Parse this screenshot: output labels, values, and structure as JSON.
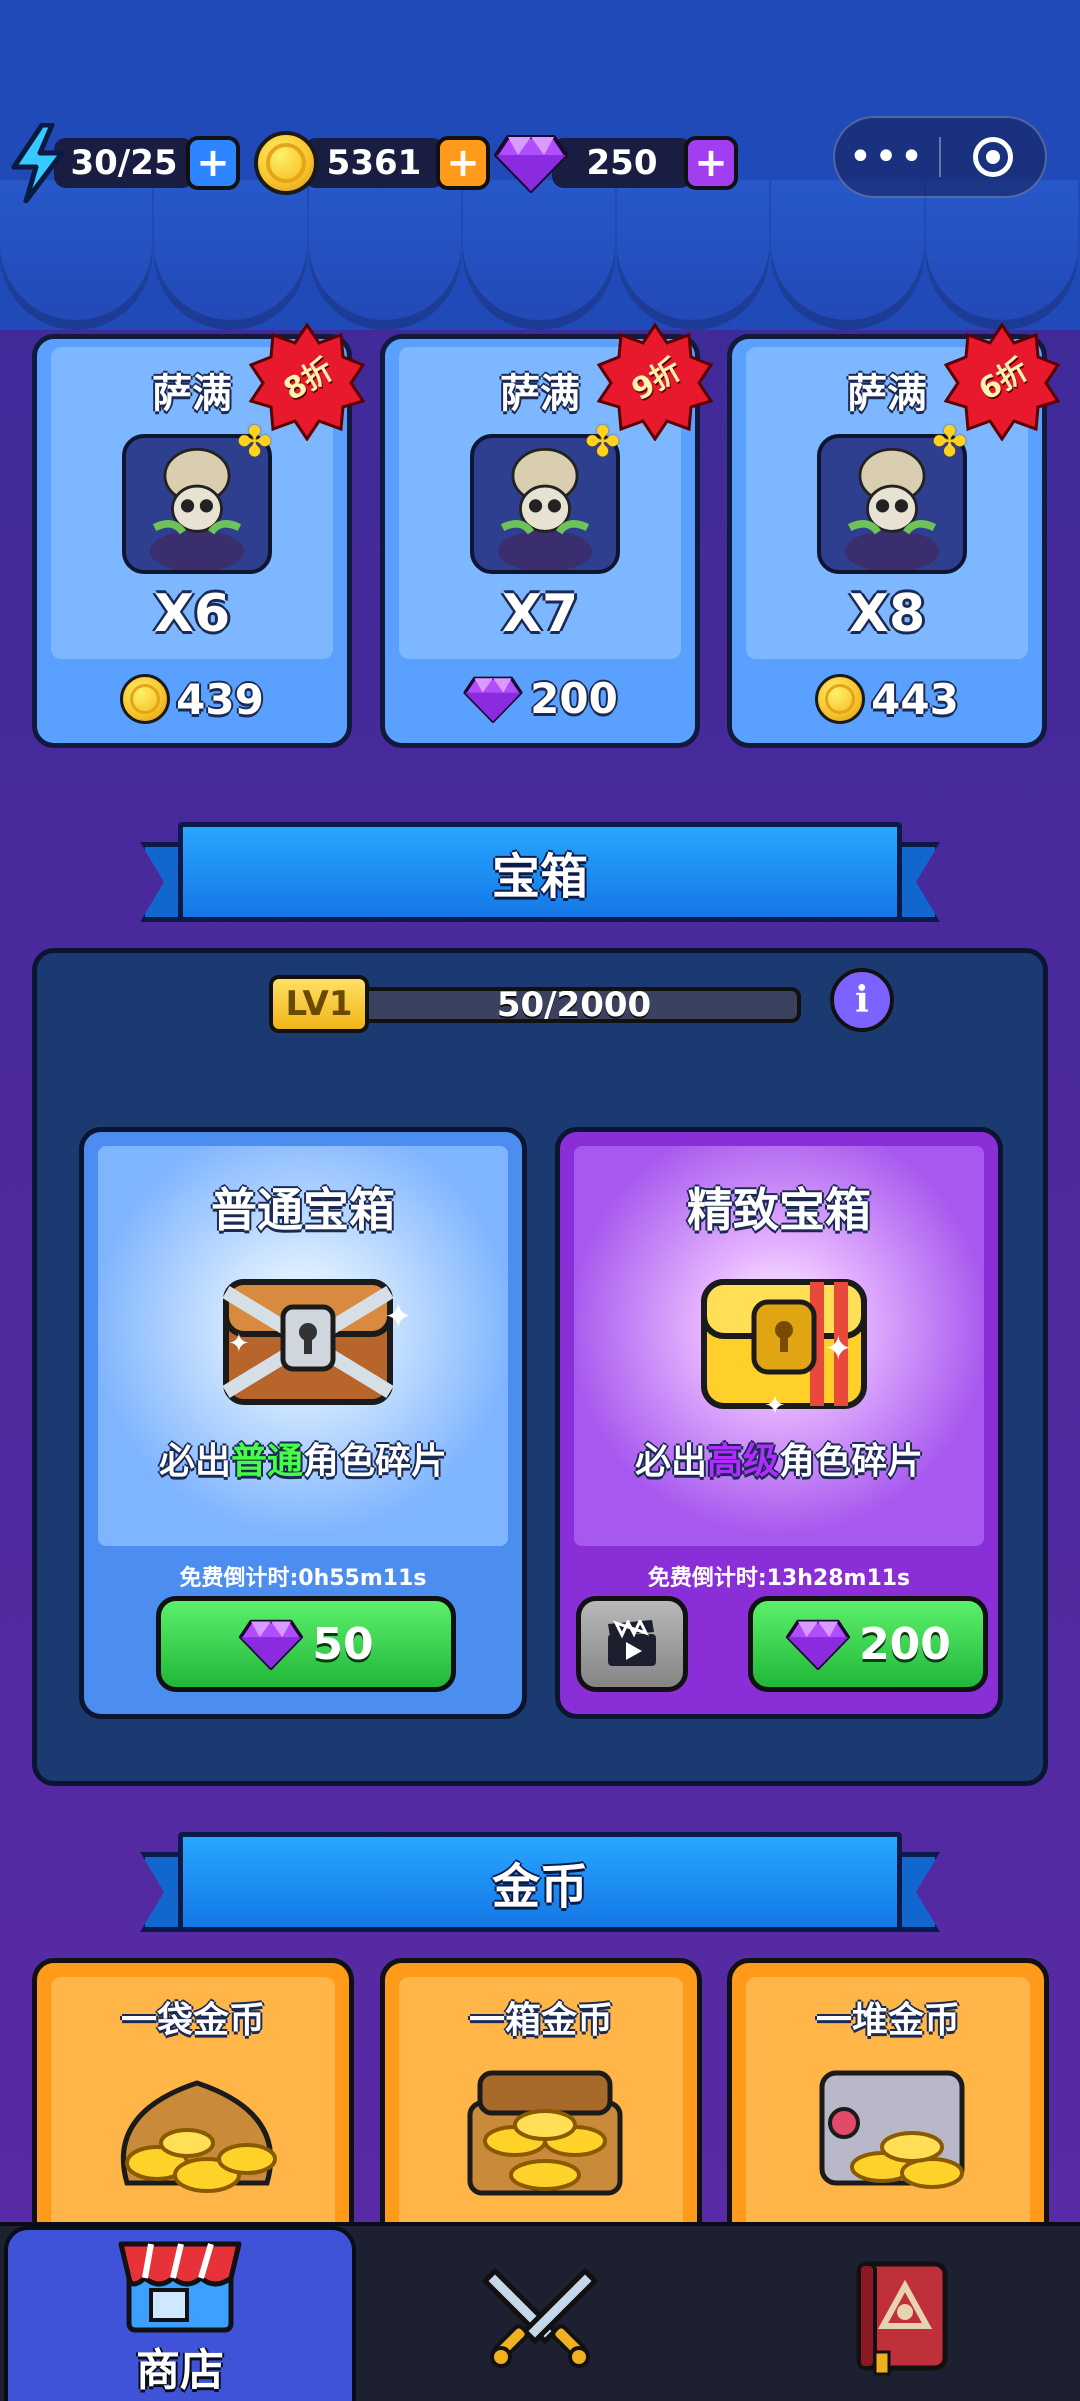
{
  "resources": {
    "energy": "30/25",
    "coins": "5361",
    "gems": "250",
    "add_label": "+"
  },
  "capsule": {
    "more_label": "•••"
  },
  "offers": [
    {
      "name": "萨满",
      "qty": "X6",
      "price": "439",
      "currency": "coin",
      "discount": "8折"
    },
    {
      "name": "萨满",
      "qty": "X7",
      "price": "200",
      "currency": "gem",
      "discount": "9折"
    },
    {
      "name": "萨满",
      "qty": "X8",
      "price": "443",
      "currency": "coin",
      "discount": "6折"
    }
  ],
  "chest_section": {
    "title": "宝箱",
    "level": "LV1",
    "progress_text": "50/2000",
    "progress_fraction": 0.025,
    "info_label": "i",
    "normal": {
      "title": "普通宝箱",
      "desc_prefix": "必出",
      "desc_highlight": "普通",
      "desc_suffix": "角色碎片",
      "timer": "免费倒计时:0h55m11s",
      "price": "50"
    },
    "premium": {
      "title": "精致宝箱",
      "desc_prefix": "必出",
      "desc_highlight": "高级",
      "desc_suffix": "角色碎片",
      "timer": "免费倒计时:13h28m11s",
      "price": "200"
    }
  },
  "gold_section": {
    "title": "金币",
    "items": [
      {
        "name": "一袋金币"
      },
      {
        "name": "一箱金币"
      },
      {
        "name": "一堆金币"
      }
    ]
  },
  "nav": {
    "tabs": [
      {
        "label": "商店",
        "icon": "shop-icon",
        "active": true
      },
      {
        "label": "",
        "icon": "battle-swords-icon",
        "active": false
      },
      {
        "label": "",
        "icon": "book-icon",
        "active": false
      }
    ]
  },
  "colors": {
    "accent_blue": "#1477e6",
    "green_button": "#21b73a",
    "premium_purple": "#8a2fd8",
    "gold_orange": "#ff9a1a"
  }
}
